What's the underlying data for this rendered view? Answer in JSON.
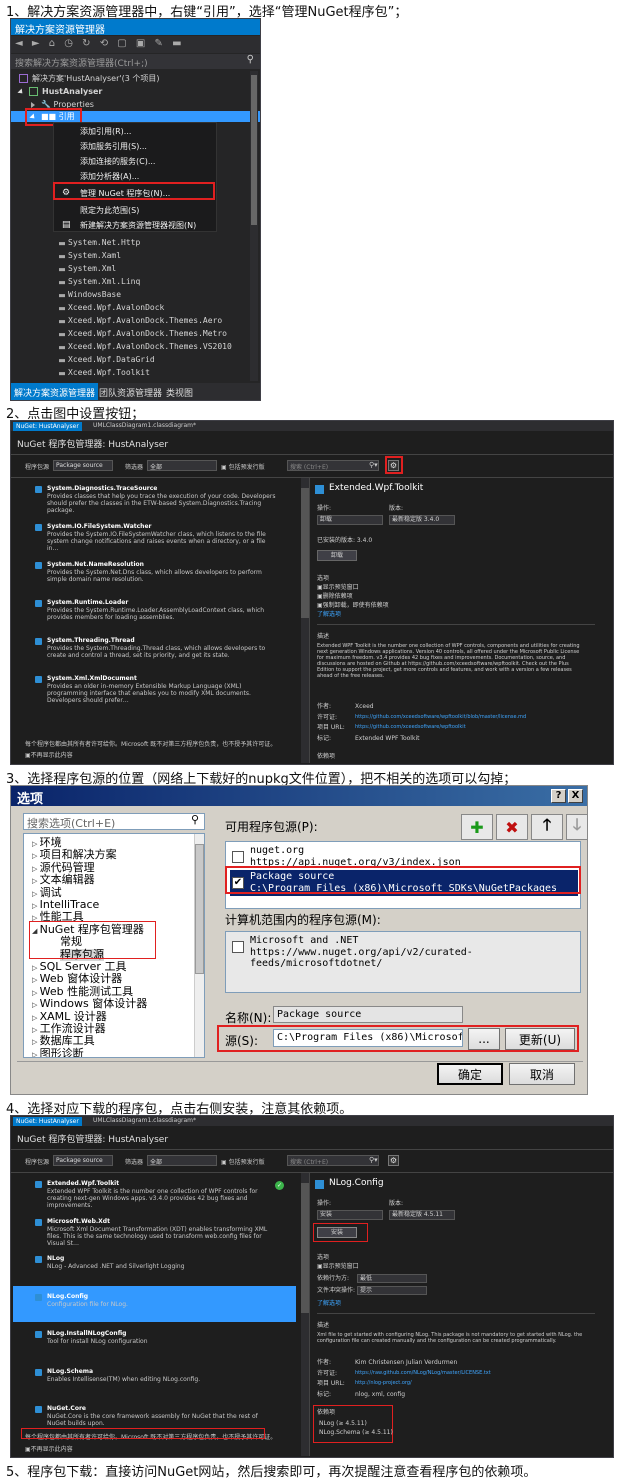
{
  "steps": {
    "s1": "1、解决方案资源管理器中，右键“引用”，选择“管理NuGet程序包”；",
    "s2": "2、点击图中设置按钮；",
    "s3": "3、选择程序包源的位置（网络上下载好的nupkg文件位置），把不相关的选项可以勾掉；",
    "s4": "4、选择对应下载的程序包，点击右侧安装，注意其依赖项。",
    "s5": "5、程序包下载：直接访问NuGet网站，然后搜索即可，再次提醒注意查看程序包的依赖项。"
  },
  "shot1": {
    "title": "解决方案资源管理器",
    "search_placeholder": "搜索解决方案资源管理器(Ctrl+;)",
    "solution": "解决方案'HustAnalyser'(3 个项目)",
    "project": "HustAnalyser",
    "properties": "Properties",
    "references": "引用",
    "menu": [
      "添加引用(R)...",
      "添加服务引用(S)...",
      "添加连接的服务(C)...",
      "添加分析器(A)...",
      "管理 NuGet 程序包(N)...",
      "限定为此范围(S)",
      "新建解决方案资源管理器视图(N)"
    ],
    "refs": [
      "System.Net.Http",
      "System.Xaml",
      "System.Xml",
      "System.Xml.Linq",
      "WindowsBase",
      "Xceed.Wpf.AvalonDock",
      "Xceed.Wpf.AvalonDock.Themes.Aero",
      "Xceed.Wpf.AvalonDock.Themes.Metro",
      "Xceed.Wpf.AvalonDock.Themes.VS2010",
      "Xceed.Wpf.DataGrid",
      "Xceed.Wpf.Toolkit"
    ],
    "tabs": [
      "解决方案资源管理器",
      "团队资源管理器",
      "类视图"
    ]
  },
  "shot2": {
    "tabs": [
      "NuGet: HustAnalyser",
      "UMLClassDiagram1.classdiagram*"
    ],
    "header": "NuGet 程序包管理器: HustAnalyser",
    "source_label": "程序包源",
    "source_value": "Package source",
    "filter_label": "筛选器",
    "filter_value": "全部",
    "prerelease": "包括预发行版",
    "search_placeholder": "搜索 (Ctrl+E)",
    "packages": [
      {
        "name": "System.Diagnostics.TraceSource",
        "desc": "Provides classes that help you trace the execution of your code. Developers should prefer the classes in the ETW-based System.Diagnostics.Tracing package."
      },
      {
        "name": "System.IO.FileSystem.Watcher",
        "desc": "Provides the System.IO.FileSystemWatcher class, which listens to the file system change notifications and raises events when a directory, or a file in…"
      },
      {
        "name": "System.Net.NameResolution",
        "desc": "Provides the System.Net.Dns class, which allows developers to perform simple domain name resolution."
      },
      {
        "name": "System.Runtime.Loader",
        "desc": "Provides the System.Runtime.Loader.AssemblyLoadContext class, which provides members for loading assemblies."
      },
      {
        "name": "System.Threading.Thread",
        "desc": "Provides the System.Threading.Thread class, which allows developers to create and control a thread, set its priority, and get its state."
      },
      {
        "name": "System.Xml.XmlDocument",
        "desc": "Provides an older in-memory Extensible Markup Language (XML) programming interface that enables you to modify XML documents. Developers should prefer…"
      }
    ],
    "footer": "每个程序包都由其所有者许可给你。Microsoft 既不对第三方程序包负责，也不授予其许可证。",
    "dont_show": "不再显示此内容",
    "detail_title": "Extended.Wpf.Toolkit",
    "action_label": "操作:",
    "version_label": "版本:",
    "action_value": "卸载",
    "version_value": "最新稳定版 3.4.0",
    "installed": "已安装的版本: 3.4.0",
    "uninstall_btn": "卸载",
    "options": "选项",
    "opt1": "显示预览窗口",
    "opt2": "删除依赖项",
    "opt3": "强制卸载，即使有依赖项",
    "learn": "了解选项",
    "desc_label": "描述",
    "desc": "Extended WPF Toolkit is the number one collection of WPF controls, components and utilities for creating next generation Windows applications. Version 40 controls, all offered under the Microsoft Public License for maximum freedom. v3.4 provides 42 bug fixes and improvements. Documentation, source, and discussions are hosted on Github at https://github.com/xceedsoftware/wpftoolkit. Check out the Plus Edition to support the project, get more controls and features, and work with a version a few releases ahead of the free releases.",
    "author_label": "作者:",
    "author": "Xceed",
    "license_label": "许可证:",
    "license": "https://github.com/xceedsoftware/wpftoolkit/blob/master/license.md",
    "url_label": "项目 URL:",
    "url": "https://github.com/xceedsoftware/wpftoolkit",
    "tags_label": "标记:",
    "tags": "Extended WPF Toolkit",
    "deps_label": "依赖项"
  },
  "shot3": {
    "title": "选项",
    "search_placeholder": "搜索选项(Ctrl+E)",
    "tree": [
      "环境",
      "项目和解决方案",
      "源代码管理",
      "文本编辑器",
      "调试",
      "IntelliTrace",
      "性能工具",
      "NuGet 程序包管理器",
      "常规",
      "程序包源",
      "SQL Server 工具",
      "Web 窗体设计器",
      "Web 性能测试工具",
      "Windows 窗体设计器",
      "XAML 设计器",
      "工作流设计器",
      "数据库工具",
      "图形诊断"
    ],
    "available_label": "可用程序包源(P):",
    "sources": [
      {
        "name": "nuget.org",
        "url": "https://api.nuget.org/v3/index.json",
        "checked": false
      },
      {
        "name": "Package source",
        "url": "C:\\Program Files (x86)\\Microsoft SDKs\\NuGetPackages",
        "checked": true
      }
    ],
    "machine_label": "计算机范围内的程序包源(M):",
    "machine": {
      "name": "Microsoft and .NET",
      "url": "https://www.nuget.org/api/v2/curated-feeds/microsoftdotnet/"
    },
    "name_label": "名称(N):",
    "name_value": "Package source",
    "source_label": "源(S):",
    "source_value": "C:\\Program Files (x86)\\Microsoft SD",
    "browse": "...",
    "update": "更新(U)",
    "ok": "确定",
    "cancel": "取消",
    "help": "?",
    "close": "X"
  },
  "shot4": {
    "packages": [
      {
        "name": "Extended.Wpf.Toolkit",
        "desc": "Extended WPF Toolkit is the number one collection of WPF controls for creating next-gen Windows apps. v3.4.0 provides 42 bug fixes and improvements."
      },
      {
        "name": "Microsoft.Web.Xdt",
        "desc": "Microsoft Xml Document Transformation (XDT) enables transforming XML files. This is the same technology used to transform web.config files for Visual St…"
      },
      {
        "name": "NLog",
        "desc": "NLog - Advanced .NET and Silverlight Logging"
      },
      {
        "name": "NLog.Config",
        "desc": "Configuration file for NLog."
      },
      {
        "name": "NLog.InstallNLogConfig",
        "desc": "Tool for install NLog configuration"
      },
      {
        "name": "NLog.Schema",
        "desc": "Enables Intellisense(TM) when editing NLog.config."
      },
      {
        "name": "NuGet.Core",
        "desc": "NuGet.Core is the core framework assembly for NuGet that the rest of NuGet builds upon."
      }
    ],
    "detail_title": "NLog.Config",
    "action_value": "安装",
    "version_value": "最新稳定版 4.5.11",
    "install_btn": "安装",
    "dep_behavior_label": "依赖行为方:",
    "dep_behavior": "最低",
    "conflict_label": "文件冲突操作:",
    "conflict": "提示",
    "desc": "Xml file to get started with configuring NLog. This package is not mandatory to get started with NLog. the configuration file can created manually and the configuration can be created programmatically.",
    "author": "Kim Christensen  Julian Verdurmen",
    "license": "https://raw.github.com/NLog/NLog/master/LICENSE.txt",
    "url": "http://nlog-project.org/",
    "tags": "nlog, xml, config",
    "deps": [
      "NLog (≥ 4.5.11)",
      "NLog.Schema (≥ 4.5.11)"
    ]
  }
}
